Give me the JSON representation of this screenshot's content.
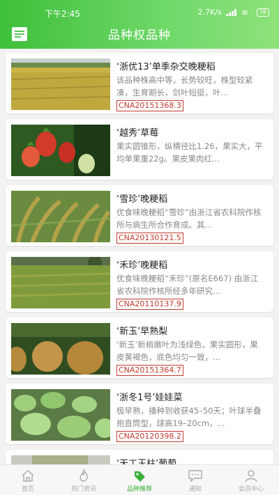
{
  "status": {
    "time": "下午2:45",
    "network": "2.7K/s",
    "battery": "78"
  },
  "header": {
    "title": "品种权品种"
  },
  "items": [
    {
      "title": "‘浙优13’单季杂交晚粳稻",
      "desc": "该品种株高中等，长势较旺，株型较紧凑，生育期长，剑叶短挺，叶...",
      "code": "CNA20151368.3",
      "image": "rice-field"
    },
    {
      "title": "‘越秀’草莓",
      "desc": "果实圆锥形，纵横径比1.26，果实大，平均单果重22g。果皮果肉红...",
      "code": "",
      "image": "strawberry"
    },
    {
      "title": "‘雪珍’晚粳稻",
      "desc": "优食味晚粳稻“雪珍”由浙江省农科院作核所与病生所合作育成。其...",
      "code": "CNA20130121.5",
      "image": "rice-ears"
    },
    {
      "title": "‘禾珍’晚粳稻",
      "desc": "优食味晚粳稻“禾珍”(原名E667) 由浙江省农科院作核所经多年研究...",
      "code": "CNA20110137.9",
      "image": "rice-field-trees"
    },
    {
      "title": "‘新玉’早熟梨",
      "desc": "‘新玉’新梢嫩叶为浅绿色，果实圆形，果皮黄褐色，底色均匀一致，...",
      "code": "CNA20151364.7",
      "image": "pear"
    },
    {
      "title": "‘浙冬1号’娃娃菜",
      "desc": "极早熟，播种到收获45–50天；叶球半叠抱直筒型，球高19–20cm，...",
      "code": "CNA20120398.2",
      "image": "cabbage"
    },
    {
      "title": "‘天工玉柱’葡萄",
      "desc": "",
      "code": "",
      "image": "grape"
    }
  ],
  "tabbar": [
    {
      "label": "首页",
      "icon": "home-icon"
    },
    {
      "label": "热门资讯",
      "icon": "flame-icon"
    },
    {
      "label": "品种推荐",
      "icon": "tag-icon",
      "active": true
    },
    {
      "label": "通知",
      "icon": "message-icon"
    },
    {
      "label": "会员中心",
      "icon": "user-icon"
    }
  ],
  "colors": {
    "accent": "#3fbf3a",
    "code": "#c03a2f"
  }
}
